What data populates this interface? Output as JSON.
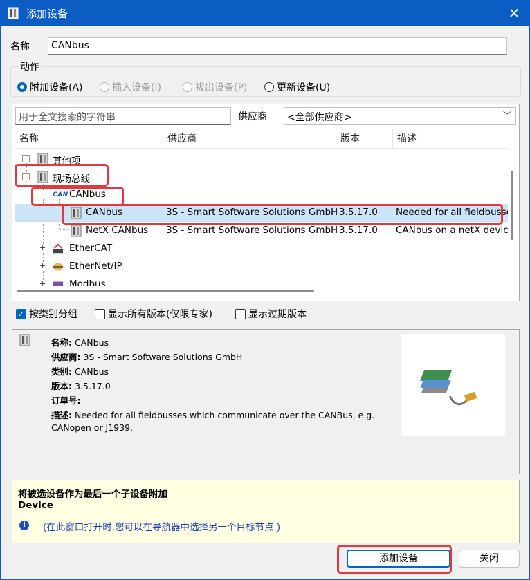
{
  "window": {
    "title": "添加设备",
    "close_glyph": "✕"
  },
  "name_field": {
    "label": "名称",
    "value": "CANbus"
  },
  "action_group": {
    "legend": "动作",
    "options": [
      {
        "label": "附加设备(A)",
        "selected": true,
        "enabled": true
      },
      {
        "label": "插入设备(I)",
        "selected": false,
        "enabled": false
      },
      {
        "label": "拔出设备(P)",
        "selected": false,
        "enabled": false
      },
      {
        "label": "更新设备(U)",
        "selected": false,
        "enabled": true
      }
    ]
  },
  "search": {
    "placeholder": "用于全文搜索的字符串"
  },
  "vendor": {
    "label": "供应商",
    "selected": "<全部供应商>"
  },
  "columns": [
    "名称",
    "供应商",
    "版本",
    "描述"
  ],
  "tree": [
    {
      "name": "其他项",
      "vendor": "",
      "version": "",
      "desc": "",
      "level": 0,
      "expander": "+",
      "icon": "device-icon"
    },
    {
      "name": "现场总线",
      "vendor": "",
      "version": "",
      "desc": "",
      "level": 0,
      "expander": "−",
      "icon": "device-icon"
    },
    {
      "name": "CANbus",
      "vendor": "",
      "version": "",
      "desc": "",
      "level": 1,
      "expander": "−",
      "icon": "can-icon",
      "icon_text": "CAN"
    },
    {
      "name": "CANbus",
      "vendor": "3S - Smart Software Solutions GmbH",
      "version": "3.5.17.0",
      "desc": "Needed for all fieldbusse",
      "level": 2,
      "selected": true,
      "icon": "device-icon"
    },
    {
      "name": "NetX CANbus",
      "vendor": "3S - Smart Software Solutions GmbH",
      "version": "3.5.17.0",
      "desc": "CANbus on a netX device",
      "level": 2,
      "icon": "device-icon"
    },
    {
      "name": "EtherCAT",
      "vendor": "",
      "version": "",
      "desc": "",
      "level": 1,
      "expander": "+",
      "icon": "ethercat-icon"
    },
    {
      "name": "EtherNet/IP",
      "vendor": "",
      "version": "",
      "desc": "",
      "level": 1,
      "expander": "+",
      "icon": "ethernetip-icon"
    },
    {
      "name": "Modbus",
      "vendor": "",
      "version": "",
      "desc": "",
      "level": 1,
      "expander": "+",
      "icon": "modbus-icon"
    }
  ],
  "options": {
    "group_by_category": {
      "label": "按类别分组",
      "checked": true
    },
    "show_all_versions": {
      "label": "显示所有版本(仅限专家)",
      "checked": false
    },
    "show_outdated": {
      "label": "显示过期版本",
      "checked": false
    }
  },
  "details": {
    "name_key": "名称:",
    "name_val": "CANbus",
    "vendor_key": "供应商:",
    "vendor_val": "3S - Smart Software Solutions GmbH",
    "category_key": "类别:",
    "category_val": "CANbus",
    "version_key": "版本:",
    "version_val": "3.5.17.0",
    "order_key": "订单号:",
    "order_val": "",
    "desc_key": "描述:",
    "desc_val": "Needed for all fieldbusses which communicate over the CANBus, e.g.",
    "desc_val2": "CANopen or J1939."
  },
  "notice": {
    "line1": "将被选设备作为最后一个子设备附加",
    "line2": "Device",
    "hint": "(在此窗口打开时,您可以在导航器中选择另一个目标节点.)"
  },
  "buttons": {
    "add": "添加设备",
    "close": "关闭"
  },
  "colors": {
    "titlebar": "#0b5dc3",
    "highlight": "#e0393e",
    "selection": "#cce4f7"
  }
}
